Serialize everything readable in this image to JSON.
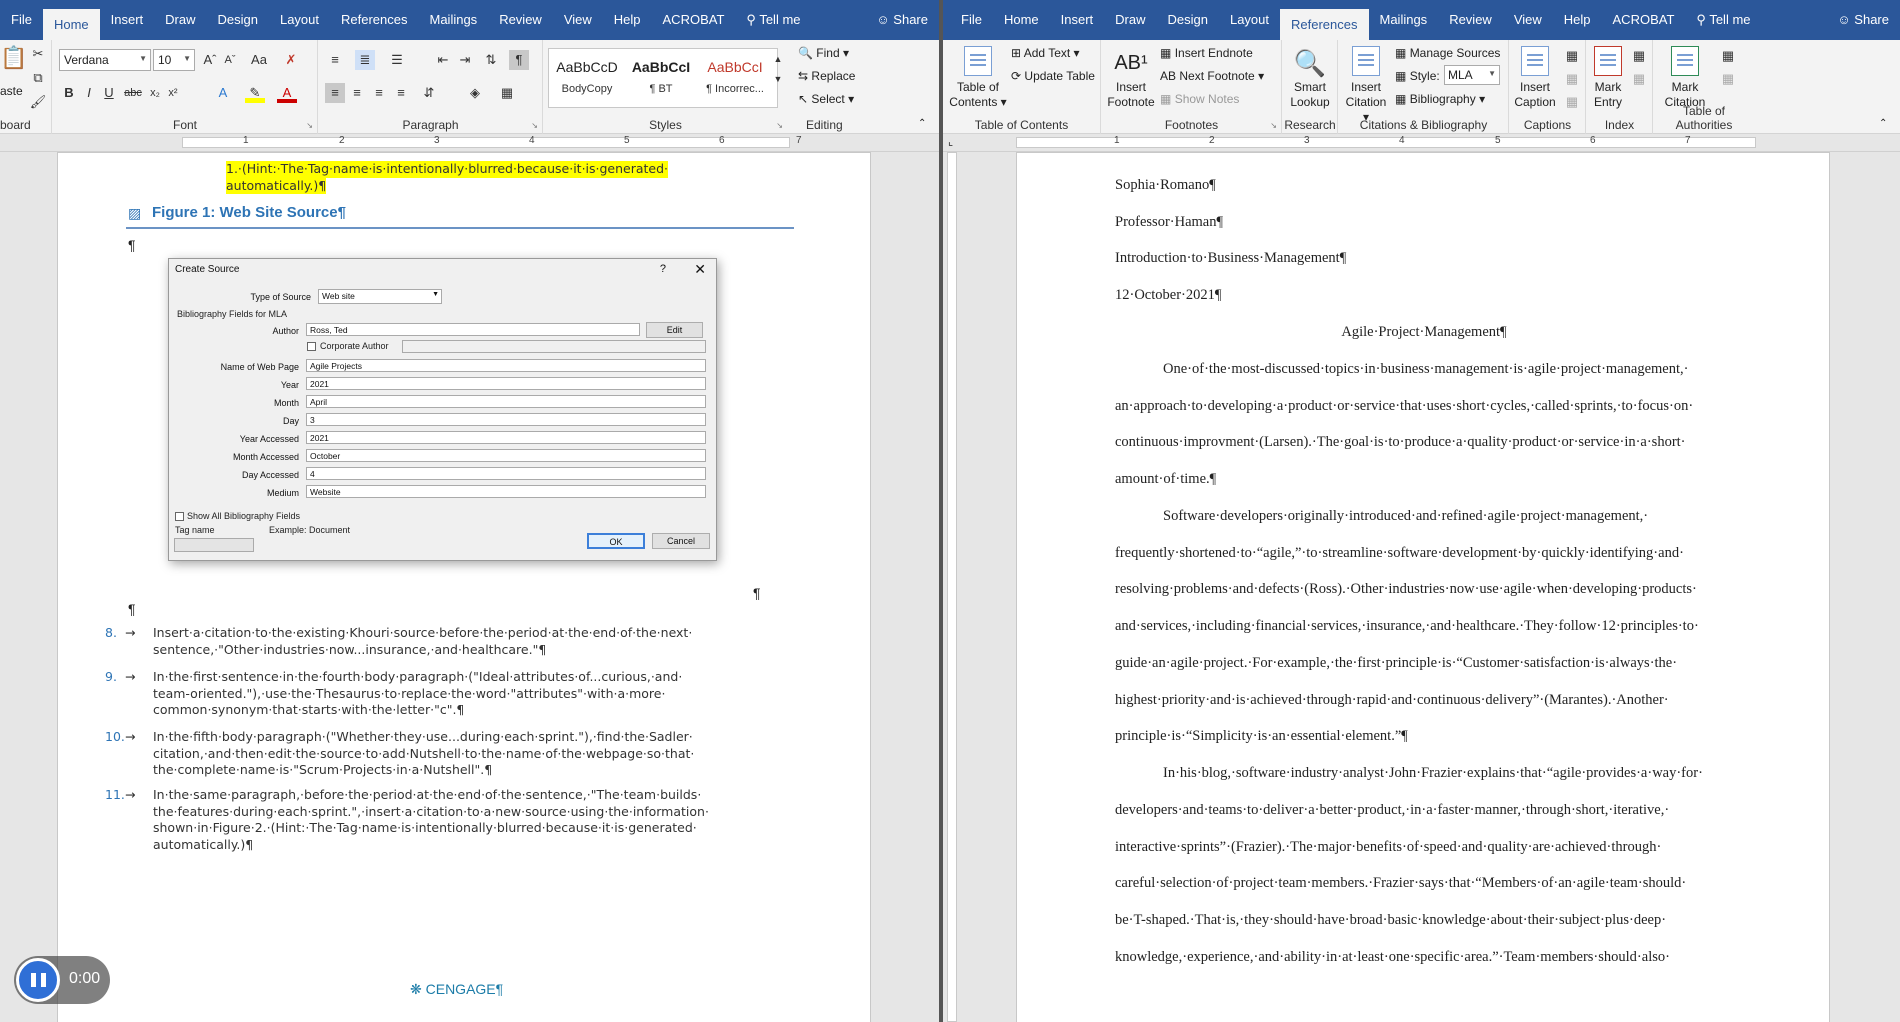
{
  "left": {
    "tabs": [
      "File",
      "Home",
      "Insert",
      "Draw",
      "Design",
      "Layout",
      "References",
      "Mailings",
      "Review",
      "View",
      "Help",
      "ACROBAT"
    ],
    "active_tab": "Home",
    "tell_me": "Tell me",
    "share": "Share",
    "clipboard": {
      "paste": "aste",
      "name": "board"
    },
    "font": {
      "name": "Verdana",
      "size": "10",
      "group": "Font",
      "case": "Aa"
    },
    "paragraph": {
      "group": "Paragraph"
    },
    "styles": {
      "group": "Styles",
      "items": [
        {
          "preview": "AaBbCcD",
          "label": "BodyCopy"
        },
        {
          "preview": "AaBbCcI",
          "label": "¶ BT"
        },
        {
          "preview": "AaBbCcI",
          "label": "¶ Incorrec..."
        }
      ]
    },
    "editing": {
      "group": "Editing",
      "find": "Find",
      "replace": "Replace",
      "select": "Select"
    },
    "doc": {
      "top_hint_1": "1.·(Hint:·The·Tag·name·is·intentionally·blurred·because·it·is·generated·",
      "top_hint_2": "automatically.)¶",
      "figure_caption": "Figure 1: Web Site Source¶",
      "pilcrow": "¶",
      "list": [
        {
          "num": "8.",
          "lines": [
            "Insert·a·citation·to·the·existing·Khouri·source·before·the·period·at·the·end·of·the·next·",
            "sentence,·\"Other·industries·now...insurance,·and·healthcare.\"¶"
          ]
        },
        {
          "num": "9.",
          "lines": [
            "In·the·first·sentence·in·the·fourth·body·paragraph·(\"Ideal·attributes·of...curious,·and·",
            "team-oriented.\"),·use·the·Thesaurus·to·replace·the·word·\"attributes\"·with·a·more·",
            "common·synonym·that·starts·with·the·letter·\"c\".¶"
          ]
        },
        {
          "num": "10.",
          "lines": [
            "In·the·fifth·body·paragraph·(\"Whether·they·use...during·each·sprint.\"),·find·the·Sadler·",
            "citation,·and·then·edit·the·source·to·add·Nutshell·to·the·name·of·the·webpage·so·that·",
            "the·complete·name·is·\"Scrum·Projects·in·a·Nutshell\".¶"
          ]
        },
        {
          "num": "11.",
          "lines": [
            "In·the·same·paragraph,·before·the·period·at·the·end·of·the·sentence,·\"The·team·builds·",
            "the·features·during·each·sprint.\",·insert·a·citation·to·a·new·source·using·the·information·",
            "shown·in·Figure·2.·(Hint:·The·Tag·name·is·intentionally·blurred·because·it·is·generated·",
            "automatically.)¶"
          ]
        }
      ],
      "footer_logo": "CENGAGE¶"
    },
    "dialog": {
      "title": "Create Source",
      "help": "?",
      "type_label": "Type of Source",
      "type_value": "Web site",
      "fields_for": "Bibliography Fields for MLA",
      "author_label": "Author",
      "author_value": "Ross, Ted",
      "edit": "Edit",
      "corporate": "Corporate Author",
      "rows": [
        {
          "label": "Name of Web Page",
          "value": "Agile Projects"
        },
        {
          "label": "Year",
          "value": "2021"
        },
        {
          "label": "Month",
          "value": "April"
        },
        {
          "label": "Day",
          "value": "3"
        },
        {
          "label": "Year Accessed",
          "value": "2021"
        },
        {
          "label": "Month Accessed",
          "value": "October"
        },
        {
          "label": "Day Accessed",
          "value": "4"
        },
        {
          "label": "Medium",
          "value": "Website"
        }
      ],
      "show_all": "Show All Bibliography Fields",
      "tag_name": "Tag name",
      "example": "Example: Document",
      "ok": "OK",
      "cancel": "Cancel"
    },
    "media": {
      "time": "0:00"
    }
  },
  "right": {
    "tabs": [
      "File",
      "Home",
      "Insert",
      "Draw",
      "Design",
      "Layout",
      "References",
      "Mailings",
      "Review",
      "View",
      "Help",
      "ACROBAT"
    ],
    "active_tab": "References",
    "tell_me": "Tell me",
    "share": "Share",
    "toc": {
      "btn": "Table of Contents",
      "add_text": "Add Text",
      "update": "Update Table",
      "group": "Table of Contents"
    },
    "footnotes": {
      "insert": "Insert Footnote",
      "insert_endnote": "Insert Endnote",
      "next": "Next Footnote",
      "show_notes": "Show Notes",
      "group": "Footnotes"
    },
    "research": {
      "lookup": "Smart Lookup",
      "group": "Research"
    },
    "citations": {
      "insert": "Insert Citation",
      "manage": "Manage Sources",
      "style_label": "Style:",
      "style_value": "MLA",
      "bibliography": "Bibliography",
      "group": "Citations & Bibliography"
    },
    "captions": {
      "insert": "Insert Caption",
      "group": "Captions"
    },
    "index": {
      "mark": "Mark Entry",
      "group": "Index"
    },
    "authorities": {
      "mark": "Mark Citation",
      "group": "Table of Authorities"
    },
    "doc": {
      "header": [
        "Sophia·Romano¶",
        "Professor·Haman¶",
        "Introduction·to·Business·Management¶",
        "12·October·2021¶"
      ],
      "title": "Agile·Project·Management¶",
      "lines": [
        "One·of·the·most-discussed·topics·in·business·management·is·agile·project·management,·",
        "an·approach·to·developing·a·product·or·service·that·uses·short·cycles,·called·sprints,·to·focus·on·",
        "continuous·improvment·(Larsen).·The·goal·is·to·produce·a·quality·product·or·service·in·a·short·",
        "amount·of·time.¶",
        "Software·developers·originally·introduced·and·refined·agile·project·management,·",
        "frequently·shortened·to·“agile,”·to·streamline·software·development·by·quickly·identifying·and·",
        "resolving·problems·and·defects·(Ross).·Other·industries·now·use·agile·when·developing·products·",
        "and·services,·including·financial·services,·insurance,·and·healthcare.·They·follow·12·principles·to·",
        "guide·an·agile·project.·For·example,·the·first·principle·is·“Customer·satisfaction·is·always·the·",
        "highest·priority·and·is·achieved·through·rapid·and·continuous·delivery”·(Marantes).·Another·",
        "principle·is·“Simplicity·is·an·essential·element.”¶",
        "In·his·blog,·software·industry·analyst·John·Frazier·explains·that·“agile·provides·a·way·for·",
        "developers·and·teams·to·deliver·a·better·product,·in·a·faster·manner,·through·short,·iterative,·",
        "interactive·sprints”·(Frazier).·The·major·benefits·of·speed·and·quality·are·achieved·through·",
        "careful·selection·of·project·team·members.·Frazier·says·that·“Members·of·an·agile·team·should·",
        "be·T-shaped.·That·is,·they·should·have·broad·basic·knowledge·about·their·subject·plus·deep·",
        "knowledge,·experience,·and·ability·in·at·least·one·specific·area.”·Team·members·should·also·"
      ]
    }
  }
}
